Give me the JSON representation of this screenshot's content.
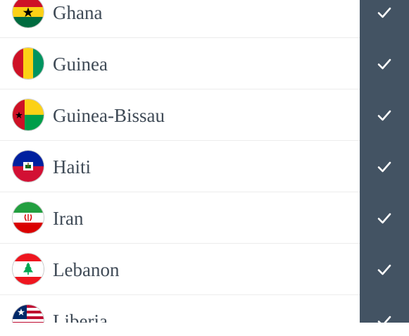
{
  "countries": [
    {
      "name": "Ghana",
      "flag_icon": "ghana-flag-icon",
      "checked": true
    },
    {
      "name": "Guinea",
      "flag_icon": "guinea-flag-icon",
      "checked": true
    },
    {
      "name": "Guinea-Bissau",
      "flag_icon": "guinea-bissau-flag-icon",
      "checked": true
    },
    {
      "name": "Haiti",
      "flag_icon": "haiti-flag-icon",
      "checked": true
    },
    {
      "name": "Iran",
      "flag_icon": "iran-flag-icon",
      "checked": true
    },
    {
      "name": "Lebanon",
      "flag_icon": "lebanon-flag-icon",
      "checked": true
    },
    {
      "name": "Liberia",
      "flag_icon": "liberia-flag-icon",
      "checked": true
    }
  ],
  "colors": {
    "check_cell_bg": "#435363",
    "text": "#3f4a56",
    "divider": "#ececec"
  }
}
